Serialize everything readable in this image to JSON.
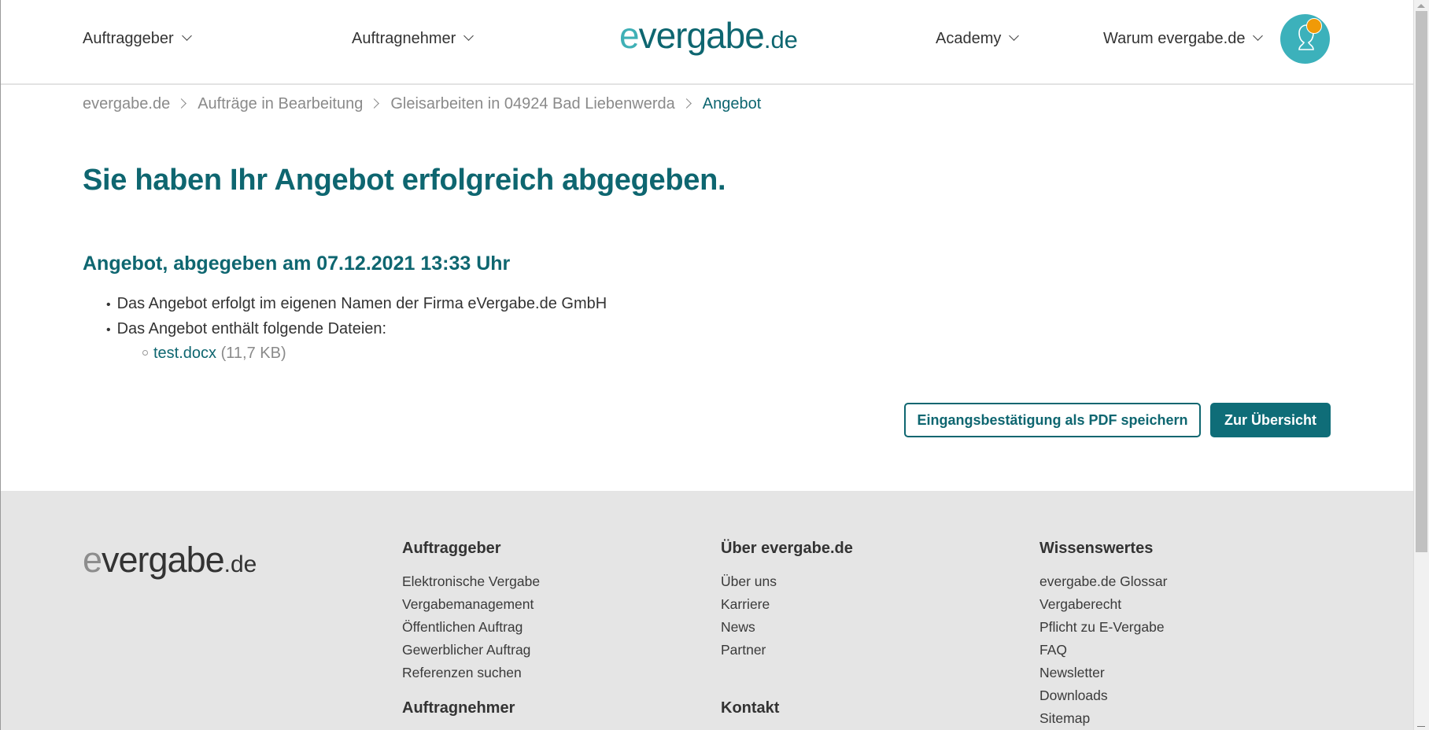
{
  "header": {
    "nav": [
      {
        "label": "Auftraggeber"
      },
      {
        "label": "Auftragnehmer"
      },
      {
        "label": "Academy"
      },
      {
        "label": "Warum evergabe.de"
      }
    ],
    "logo": {
      "e": "e",
      "main": "vergabe",
      "tld": ".de"
    },
    "avatar_icon": "user-icon",
    "notification_color": "#f09a07"
  },
  "breadcrumb": [
    {
      "label": "evergabe.de"
    },
    {
      "label": "Aufträge in Bearbeitung"
    },
    {
      "label": "Gleisarbeiten in 04924 Bad Liebenwerda"
    },
    {
      "label": "Angebot"
    }
  ],
  "main": {
    "title": "Sie haben Ihr Angebot erfolgreich abgegeben.",
    "subtitle": "Angebot, abgegeben am 07.12.2021 13:33 Uhr",
    "bullets": [
      "Das Angebot erfolgt im eigenen Namen der Firma eVergabe.de GmbH",
      "Das Angebot enthält folgende Dateien:"
    ],
    "files": [
      {
        "name": "test.docx",
        "size": "(11,7 KB)"
      }
    ],
    "buttons": {
      "save_pdf": "Eingangsbestätigung als PDF speichern",
      "overview": "Zur Übersicht"
    }
  },
  "footer": {
    "logo": {
      "e": "e",
      "main": "vergabe",
      "tld": ".de"
    },
    "columns": [
      {
        "heading": "Auftraggeber",
        "links": [
          "Elektronische Vergabe",
          "Vergabemanagement",
          "Öffentlichen Auftrag",
          "Gewerblicher Auftrag",
          "Referenzen suchen"
        ],
        "heading2": "Auftragnehmer"
      },
      {
        "heading": "Über evergabe.de",
        "links": [
          "Über uns",
          "Karriere",
          "News",
          "Partner"
        ],
        "heading2": "Kontakt"
      },
      {
        "heading": "Wissenswertes",
        "links": [
          "evergabe.de Glossar",
          "Vergaberecht",
          "Pflicht zu E-Vergabe",
          "FAQ",
          "Newsletter",
          "Downloads",
          "Sitemap"
        ]
      }
    ]
  },
  "colors": {
    "brand": "#0e6670",
    "brand_light": "#3fb0b6",
    "button_primary": "#0f6d78",
    "footer_bg": "#e5e5e5"
  }
}
